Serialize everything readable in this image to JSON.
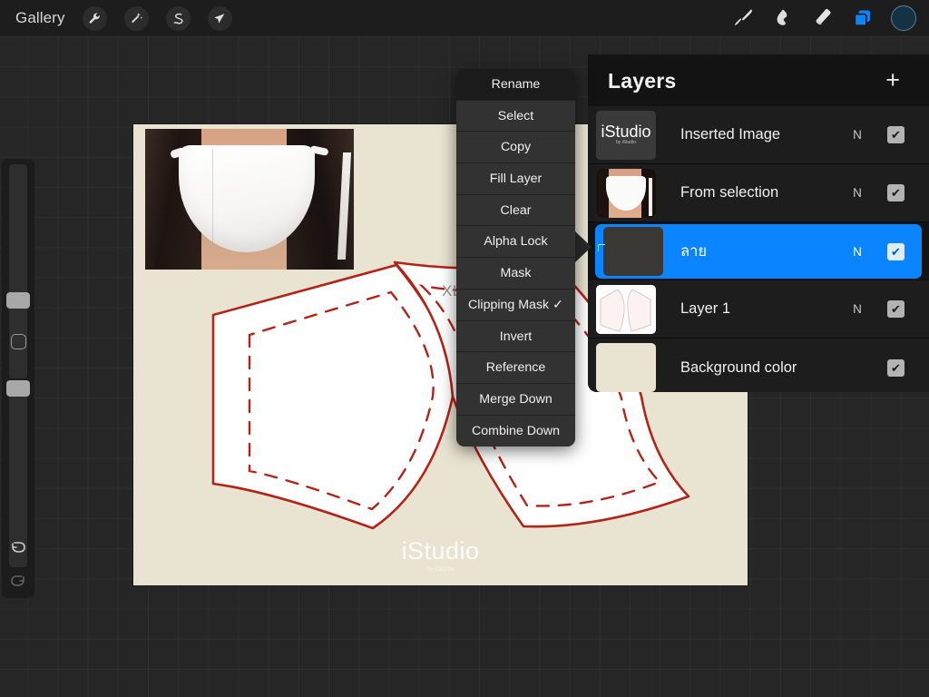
{
  "app": {
    "name": "Procreate",
    "accent_color": "#0a84ff",
    "canvas_background": "#e9e4d1",
    "ui_background": "#262626"
  },
  "topbar": {
    "gallery_label": "Gallery",
    "left_tools": [
      {
        "name": "wrench-icon",
        "label": "Actions"
      },
      {
        "name": "magic-wand-icon",
        "label": "Adjustments"
      },
      {
        "name": "selection-icon",
        "label": "Selection"
      },
      {
        "name": "transform-arrow-icon",
        "label": "Transform"
      }
    ],
    "right_tools": [
      {
        "name": "paintbrush-icon",
        "label": "Paint"
      },
      {
        "name": "smudge-icon",
        "label": "Smudge"
      },
      {
        "name": "eraser-icon",
        "label": "Erase"
      },
      {
        "name": "layers-icon",
        "label": "Layers",
        "active": true
      }
    ],
    "color_swatch": "#143243"
  },
  "sidebar": {
    "brush_size_label": "Brush size",
    "opacity_label": "Opacity",
    "modify_label": "Modify",
    "undo_label": "Undo",
    "redo_label": "Redo",
    "redo_disabled": true
  },
  "context_menu": {
    "items": [
      {
        "label": "Rename",
        "checked": false
      },
      {
        "label": "Select",
        "checked": false
      },
      {
        "label": "Copy",
        "checked": false
      },
      {
        "label": "Fill Layer",
        "checked": false
      },
      {
        "label": "Clear",
        "checked": false
      },
      {
        "label": "Alpha Lock",
        "checked": false
      },
      {
        "label": "Mask",
        "checked": false
      },
      {
        "label": "Clipping Mask ✓",
        "checked": true
      },
      {
        "label": "Invert",
        "checked": false
      },
      {
        "label": "Reference",
        "checked": false
      },
      {
        "label": "Merge Down",
        "checked": false
      },
      {
        "label": "Combine Down",
        "checked": false
      }
    ]
  },
  "layers_panel": {
    "title": "Layers",
    "add_button": "+",
    "layers": [
      {
        "name": "Inserted Image",
        "blend_mode": "N",
        "visible": true,
        "check": "✔",
        "selected": false,
        "thumbnail": "istudio-logo",
        "thumbnail_text": "iStudio",
        "thumbnail_subtext": "by iStudio"
      },
      {
        "name": "From selection",
        "blend_mode": "N",
        "visible": true,
        "check": "✔",
        "selected": false,
        "thumbnail": "mask-photo"
      },
      {
        "name": "ลาย",
        "blend_mode": "N",
        "visible": true,
        "check": "✔",
        "selected": true,
        "clipping_mask": true,
        "thumbnail": "empty"
      },
      {
        "name": "Layer 1",
        "blend_mode": "N",
        "visible": true,
        "check": "✔",
        "selected": false,
        "thumbnail": "pattern-pieces"
      },
      {
        "name": "Background color",
        "blend_mode": "",
        "visible": true,
        "check": "✔",
        "selected": false,
        "thumbnail": "background-swatch"
      }
    ]
  },
  "canvas": {
    "size_label": "XL",
    "watermark": "iStudio",
    "watermark_subtext": "by iStudio",
    "pattern_outline_color": "#b32318",
    "pattern_fill_color": "#ffffff",
    "photo_alt": "woman wearing white face mask"
  }
}
